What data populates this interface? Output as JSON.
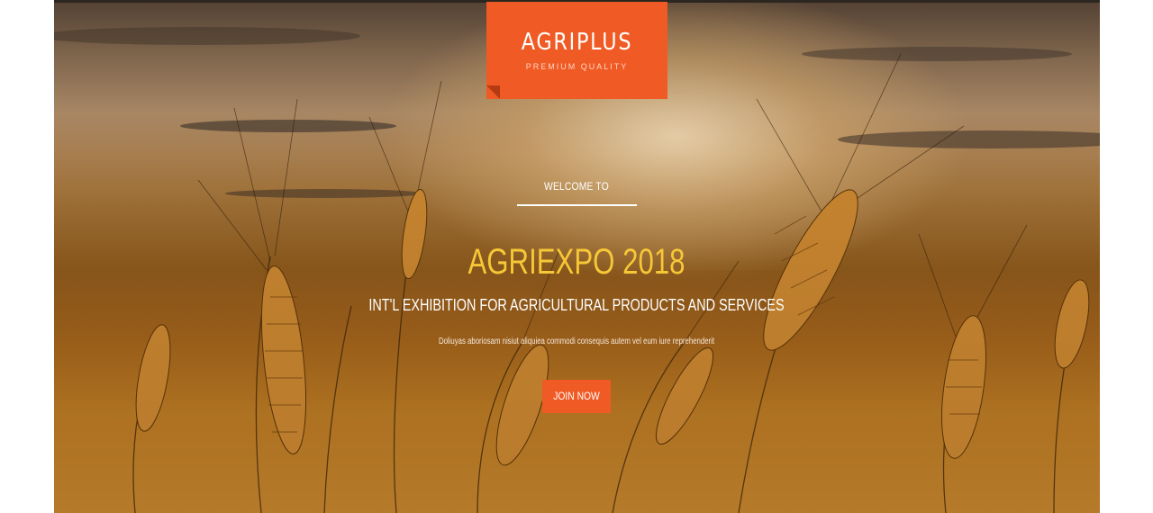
{
  "brand": {
    "name": "AGRIPLUS",
    "tagline": "PREMIUM QUALITY",
    "accent_color": "#f05a24"
  },
  "hero": {
    "eyebrow": "WELCOME TO",
    "title": "AGRIEXPO 2018",
    "subtitle": "INT'L EXHIBITION FOR AGRICULTURAL PRODUCTS AND SERVICES",
    "description": "Doliuyas aboriosam nisiut aliquiea commodi consequis autem vel eum iure reprehenderit",
    "cta_label": "JOIN NOW",
    "title_color": "#f6c736",
    "background_image": "wheat-field-sunset"
  }
}
